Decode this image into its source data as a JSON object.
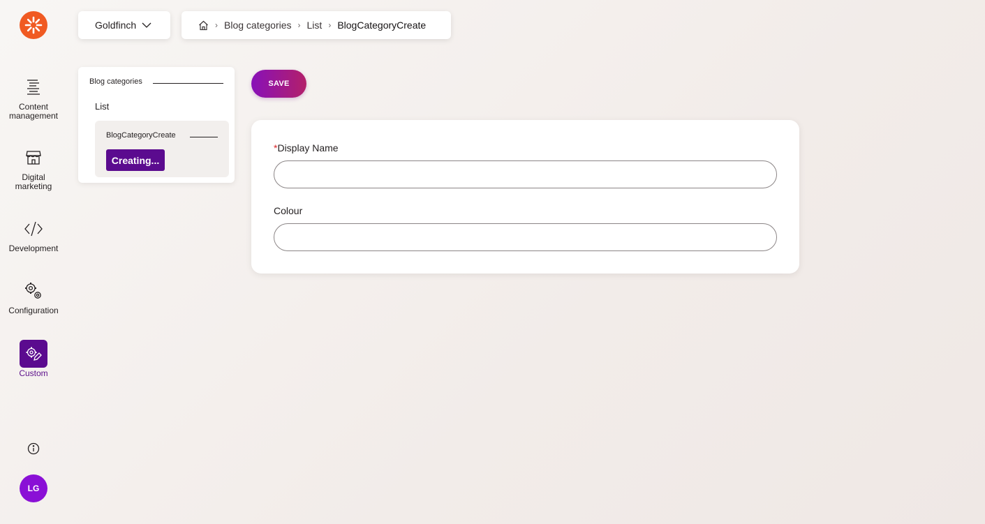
{
  "rail": {
    "items": [
      {
        "label": "Content management",
        "icon": "content-list-icon"
      },
      {
        "label": "Digital marketing",
        "icon": "storefront-icon"
      },
      {
        "label": "Development",
        "icon": "code-icon"
      },
      {
        "label": "Configuration",
        "icon": "gears-icon"
      },
      {
        "label": "Custom",
        "icon": "custom-gear-pencil-icon",
        "active": true
      }
    ],
    "avatar_initials": "LG"
  },
  "project": {
    "name": "Goldfinch"
  },
  "breadcrumb": {
    "home_icon": "home-icon",
    "items": [
      "Blog categories",
      "List",
      "BlogCategoryCreate"
    ]
  },
  "nav": {
    "title": "Blog categories",
    "list_label": "List",
    "sub_title": "BlogCategoryCreate",
    "creating_label": "Creating..."
  },
  "toolbar": {
    "save_label": "SAVE"
  },
  "form": {
    "fields": [
      {
        "label": "Display Name",
        "required": true,
        "value": ""
      },
      {
        "label": "Colour",
        "required": false,
        "value": ""
      }
    ]
  },
  "colors": {
    "brand_orange": "#f05a22",
    "accent_purple": "#5b0b8f",
    "avatar_purple": "#8a10d6",
    "save_gradient_start": "#8810b8",
    "save_gradient_end": "#b3206a",
    "required_red": "#d8262a"
  }
}
